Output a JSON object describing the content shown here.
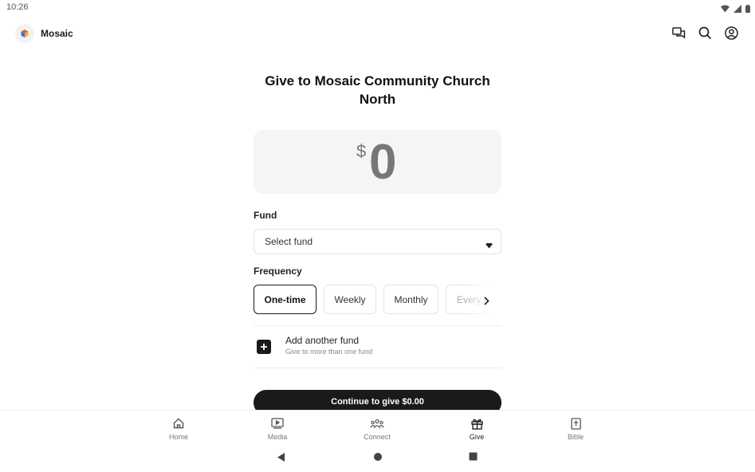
{
  "status_bar": {
    "time": "10:26"
  },
  "app_bar": {
    "brand_name": "Mosaic",
    "actions": [
      "messages-icon",
      "search-icon",
      "account-icon"
    ]
  },
  "give": {
    "title": "Give to Mosaic Community Church North",
    "amount": {
      "currency": "$",
      "value": "0"
    },
    "fund": {
      "label": "Fund",
      "placeholder": "Select fund"
    },
    "frequency": {
      "label": "Frequency",
      "options": [
        "One-time",
        "Weekly",
        "Monthly",
        "Every two"
      ],
      "selected": "One-time"
    },
    "add_fund": {
      "title": "Add another fund",
      "subtitle": "Give to more than one fund"
    },
    "continue_label": "Continue to give $0.00"
  },
  "bottom_nav": {
    "items": [
      {
        "label": "Home",
        "icon": "home-icon"
      },
      {
        "label": "Media",
        "icon": "media-icon"
      },
      {
        "label": "Connect",
        "icon": "connect-icon"
      },
      {
        "label": "Give",
        "icon": "gift-icon"
      },
      {
        "label": "Bible",
        "icon": "bible-icon"
      }
    ],
    "active": "Give"
  },
  "colors": {
    "primary": "#1a1a1a",
    "amount_bg": "#f4f5f6",
    "muted_text": "#777777"
  }
}
